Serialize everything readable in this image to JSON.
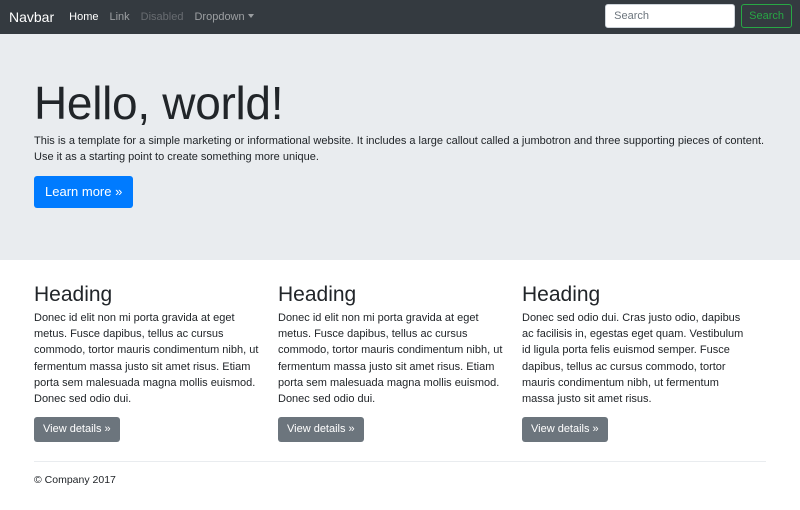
{
  "navbar": {
    "brand": "Navbar",
    "links": [
      {
        "label": "Home",
        "state": "active"
      },
      {
        "label": "Link",
        "state": "normal"
      },
      {
        "label": "Disabled",
        "state": "disabled"
      },
      {
        "label": "Dropdown",
        "state": "normal",
        "icon": "caret-down-icon"
      }
    ],
    "search": {
      "placeholder": "Search",
      "value": "",
      "button_label": "Search"
    }
  },
  "jumbotron": {
    "title": "Hello, world!",
    "lead": "This is a template for a simple marketing or informational website. It includes a large callout called a jumbotron and three supporting pieces of content. Use it as a starting point to create something more unique.",
    "button_label": "Learn more »"
  },
  "columns": [
    {
      "heading": "Heading",
      "text": "Donec id elit non mi porta gravida at eget metus. Fusce dapibus, tellus ac cursus commodo, tortor mauris condimentum nibh, ut fermentum massa justo sit amet risus. Etiam porta sem malesuada magna mollis euismod. Donec sed odio dui.",
      "button_label": "View details »"
    },
    {
      "heading": "Heading",
      "text": "Donec id elit non mi porta gravida at eget metus. Fusce dapibus, tellus ac cursus commodo, tortor mauris condimentum nibh, ut fermentum massa justo sit amet risus. Etiam porta sem malesuada magna mollis euismod. Donec sed odio dui.",
      "button_label": "View details »"
    },
    {
      "heading": "Heading",
      "text": "Donec sed odio dui. Cras justo odio, dapibus ac facilisis in, egestas eget quam. Vestibulum id ligula porta felis euismod semper. Fusce dapibus, tellus ac cursus commodo, tortor mauris condimentum nibh, ut fermentum massa justo sit amet risus.",
      "button_label": "View details »"
    }
  ],
  "footer": {
    "text": "© Company 2017"
  },
  "colors": {
    "navbar_bg": "#343a40",
    "jumbotron_bg": "#e9ecef",
    "primary": "#007bff",
    "secondary": "#6c757d",
    "success": "#28a745"
  }
}
